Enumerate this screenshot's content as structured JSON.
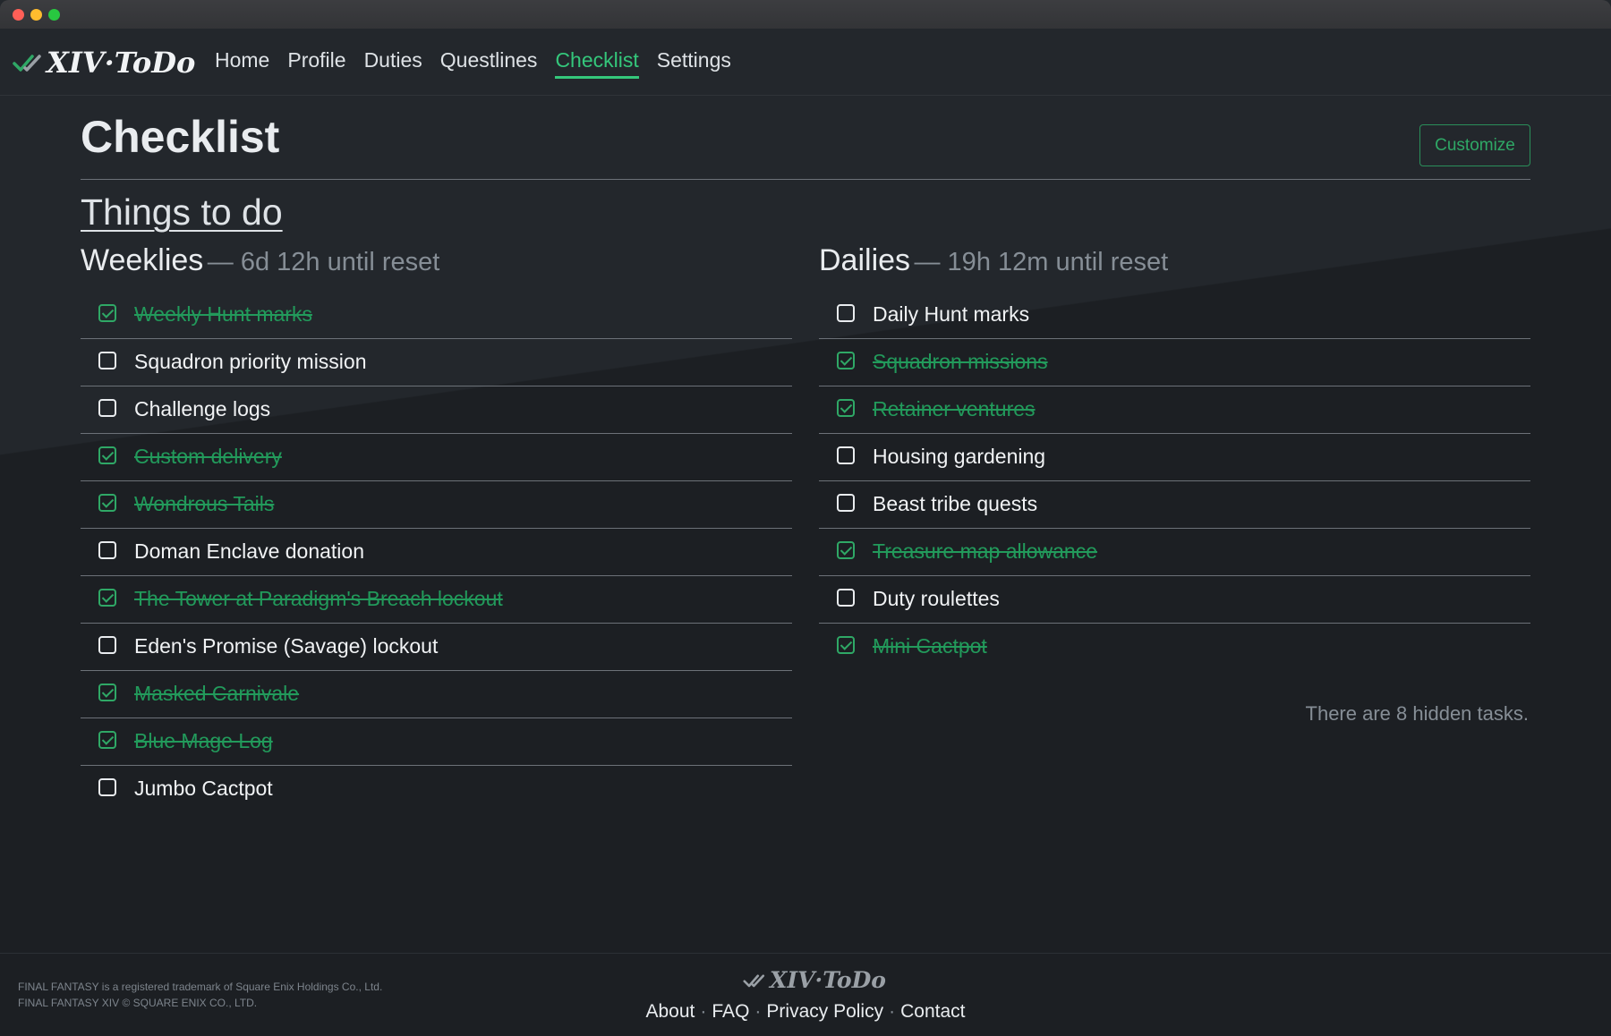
{
  "app": {
    "logo_text": "XIV·ToDo"
  },
  "nav": {
    "items": [
      {
        "label": "Home"
      },
      {
        "label": "Profile"
      },
      {
        "label": "Duties"
      },
      {
        "label": "Questlines"
      },
      {
        "label": "Checklist"
      },
      {
        "label": "Settings"
      }
    ]
  },
  "page": {
    "title": "Checklist",
    "customize_label": "Customize",
    "section_heading": "Things to do"
  },
  "weeklies": {
    "name": "Weeklies",
    "reset": "— 6d 12h until reset",
    "tasks": [
      {
        "label": "Weekly Hunt marks",
        "done": true
      },
      {
        "label": "Squadron priority mission",
        "done": false
      },
      {
        "label": "Challenge logs",
        "done": false
      },
      {
        "label": "Custom delivery",
        "done": true
      },
      {
        "label": "Wondrous Tails",
        "done": true
      },
      {
        "label": "Doman Enclave donation",
        "done": false
      },
      {
        "label": "The Tower at Paradigm's Breach lockout",
        "done": true
      },
      {
        "label": "Eden's Promise (Savage) lockout",
        "done": false
      },
      {
        "label": "Masked Carnivale",
        "done": true
      },
      {
        "label": "Blue Mage Log",
        "done": true
      },
      {
        "label": "Jumbo Cactpot",
        "done": false
      }
    ]
  },
  "dailies": {
    "name": "Dailies",
    "reset": "— 19h 12m until reset",
    "tasks": [
      {
        "label": "Daily Hunt marks",
        "done": false
      },
      {
        "label": "Squadron missions",
        "done": true
      },
      {
        "label": "Retainer ventures",
        "done": true
      },
      {
        "label": "Housing gardening",
        "done": false
      },
      {
        "label": "Beast tribe quests",
        "done": false
      },
      {
        "label": "Treasure map allowance",
        "done": true
      },
      {
        "label": "Duty roulettes",
        "done": false
      },
      {
        "label": "Mini Cactpot",
        "done": true
      }
    ],
    "hidden_note": "There are 8 hidden tasks."
  },
  "footer": {
    "legal_line1": "FINAL FANTASY is a registered trademark of Square Enix Holdings Co., Ltd.",
    "legal_line2": "FINAL FANTASY XIV © SQUARE ENIX CO., LTD.",
    "links": [
      {
        "label": "About"
      },
      {
        "label": "FAQ"
      },
      {
        "label": "Privacy Policy"
      },
      {
        "label": "Contact"
      }
    ],
    "separator": "·"
  },
  "colors": {
    "accent": "#34c77b",
    "done_text": "#229a5b",
    "background": "#1c1f23"
  },
  "icons": {
    "logo": "double-check-icon",
    "checkbox_checked": "checkmark-icon"
  }
}
